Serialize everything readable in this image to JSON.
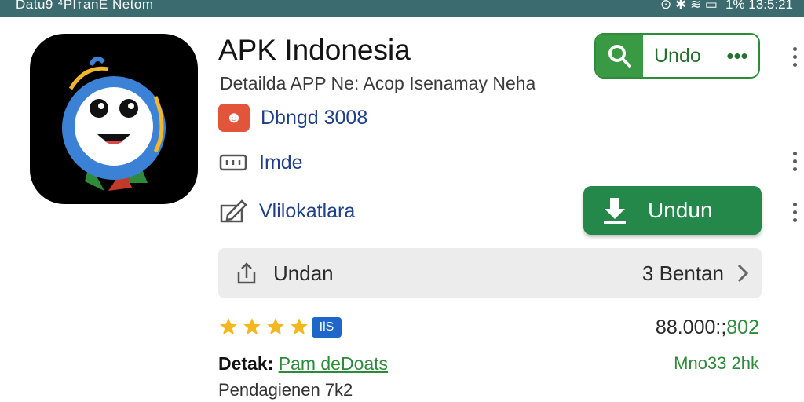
{
  "status_bar": {
    "left_text": "Datu9  ⁴Pl↑anE Netom",
    "right_text": "1%  13:5:21",
    "background": "#3b6b6e"
  },
  "app": {
    "title": "APK Indonesia",
    "subtitle": "Detailda APP Ne: Acop Isenamay Neha",
    "developer": "Dbngd 3008",
    "rating_row": "Imde",
    "category": "Vlilokatlara"
  },
  "top_chip": {
    "label": "Undo",
    "more": "•••"
  },
  "install_button": {
    "label": "Undun",
    "color": "#23884a"
  },
  "share_bar": {
    "label": "Undan",
    "right_label": "3 Bentan"
  },
  "rating": {
    "stars": 4,
    "badge": "IƖS",
    "count_prefix": "88.000:;",
    "count_suffix": "802"
  },
  "detail": {
    "key": "Detak:",
    "link": "Pam deDoats",
    "size": "Mno33 2hk",
    "footer": "Pendagienen 7k2"
  },
  "icons": [
    "search-icon",
    "more-icon",
    "developer-icon",
    "keyboard-icon",
    "edit-icon",
    "download-icon",
    "share-icon",
    "chevron-right-icon",
    "star-icon",
    "kebab-icon"
  ]
}
